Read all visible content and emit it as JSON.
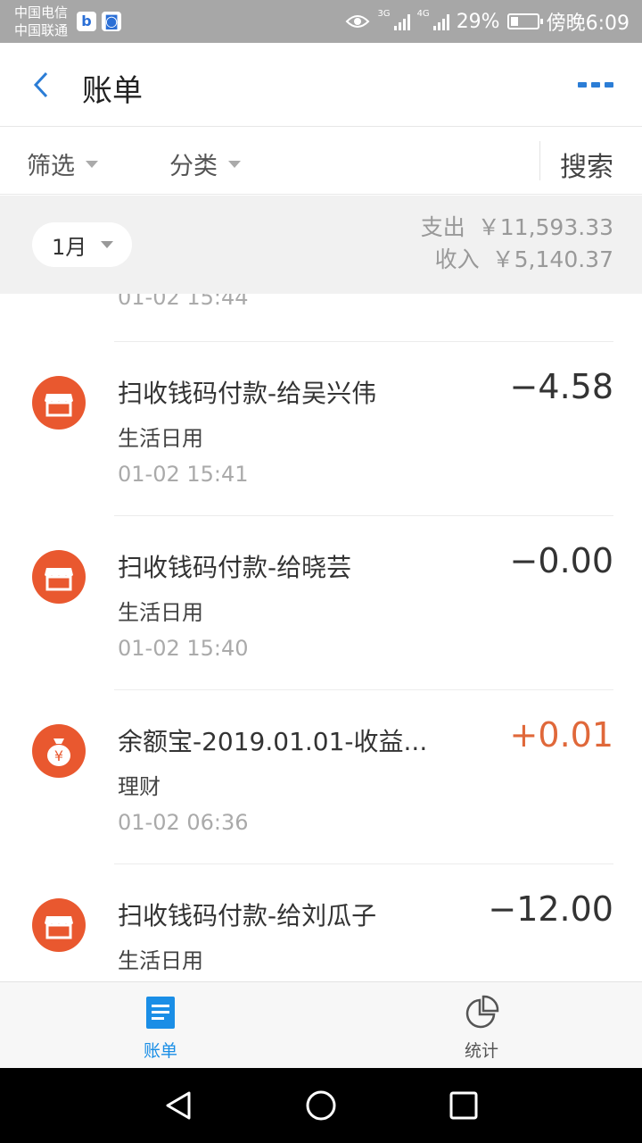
{
  "status_bar": {
    "carrier_1": "中国电信",
    "carrier_2": "中国联通",
    "app_icons": [
      "baidu-icon",
      "app-notification-icon"
    ],
    "net_label_1": "3G",
    "net_label_2": "4G",
    "battery": "29%",
    "time": "傍晚6:09"
  },
  "header": {
    "title": "账单"
  },
  "filters": {
    "filter_label": "筛选",
    "category_label": "分类",
    "search_label": "搜索"
  },
  "summary": {
    "month": "1月",
    "expense_label": "支出",
    "expense_value": "￥11,593.33",
    "income_label": "收入",
    "income_value": "￥5,140.37"
  },
  "list": {
    "previous_time": "01-02  15:44",
    "items": [
      {
        "title": "扫收钱码付款-给吴兴伟",
        "category": "生活日用",
        "time": "01-02  15:41",
        "amount": "−4.58",
        "icon": "shop-icon"
      },
      {
        "title": "扫收钱码付款-给晓芸",
        "category": "生活日用",
        "time": "01-02  15:40",
        "amount": "−0.00",
        "icon": "shop-icon"
      },
      {
        "title": "余额宝-2019.01.01-收益...",
        "category": "理财",
        "time": "01-02  06:36",
        "amount": "+0.01",
        "icon": "money-bag-icon"
      },
      {
        "title": "扫收钱码付款-给刘瓜子",
        "category": "生活日用",
        "time": "",
        "amount": "−12.00",
        "icon": "shop-icon"
      }
    ]
  },
  "tabs": [
    {
      "label": "账单",
      "active": true
    },
    {
      "label": "统计",
      "active": false
    }
  ],
  "colors": {
    "accent": "#1a8ee6",
    "icon_bg": "#e9582f",
    "income": "#e0683a"
  }
}
